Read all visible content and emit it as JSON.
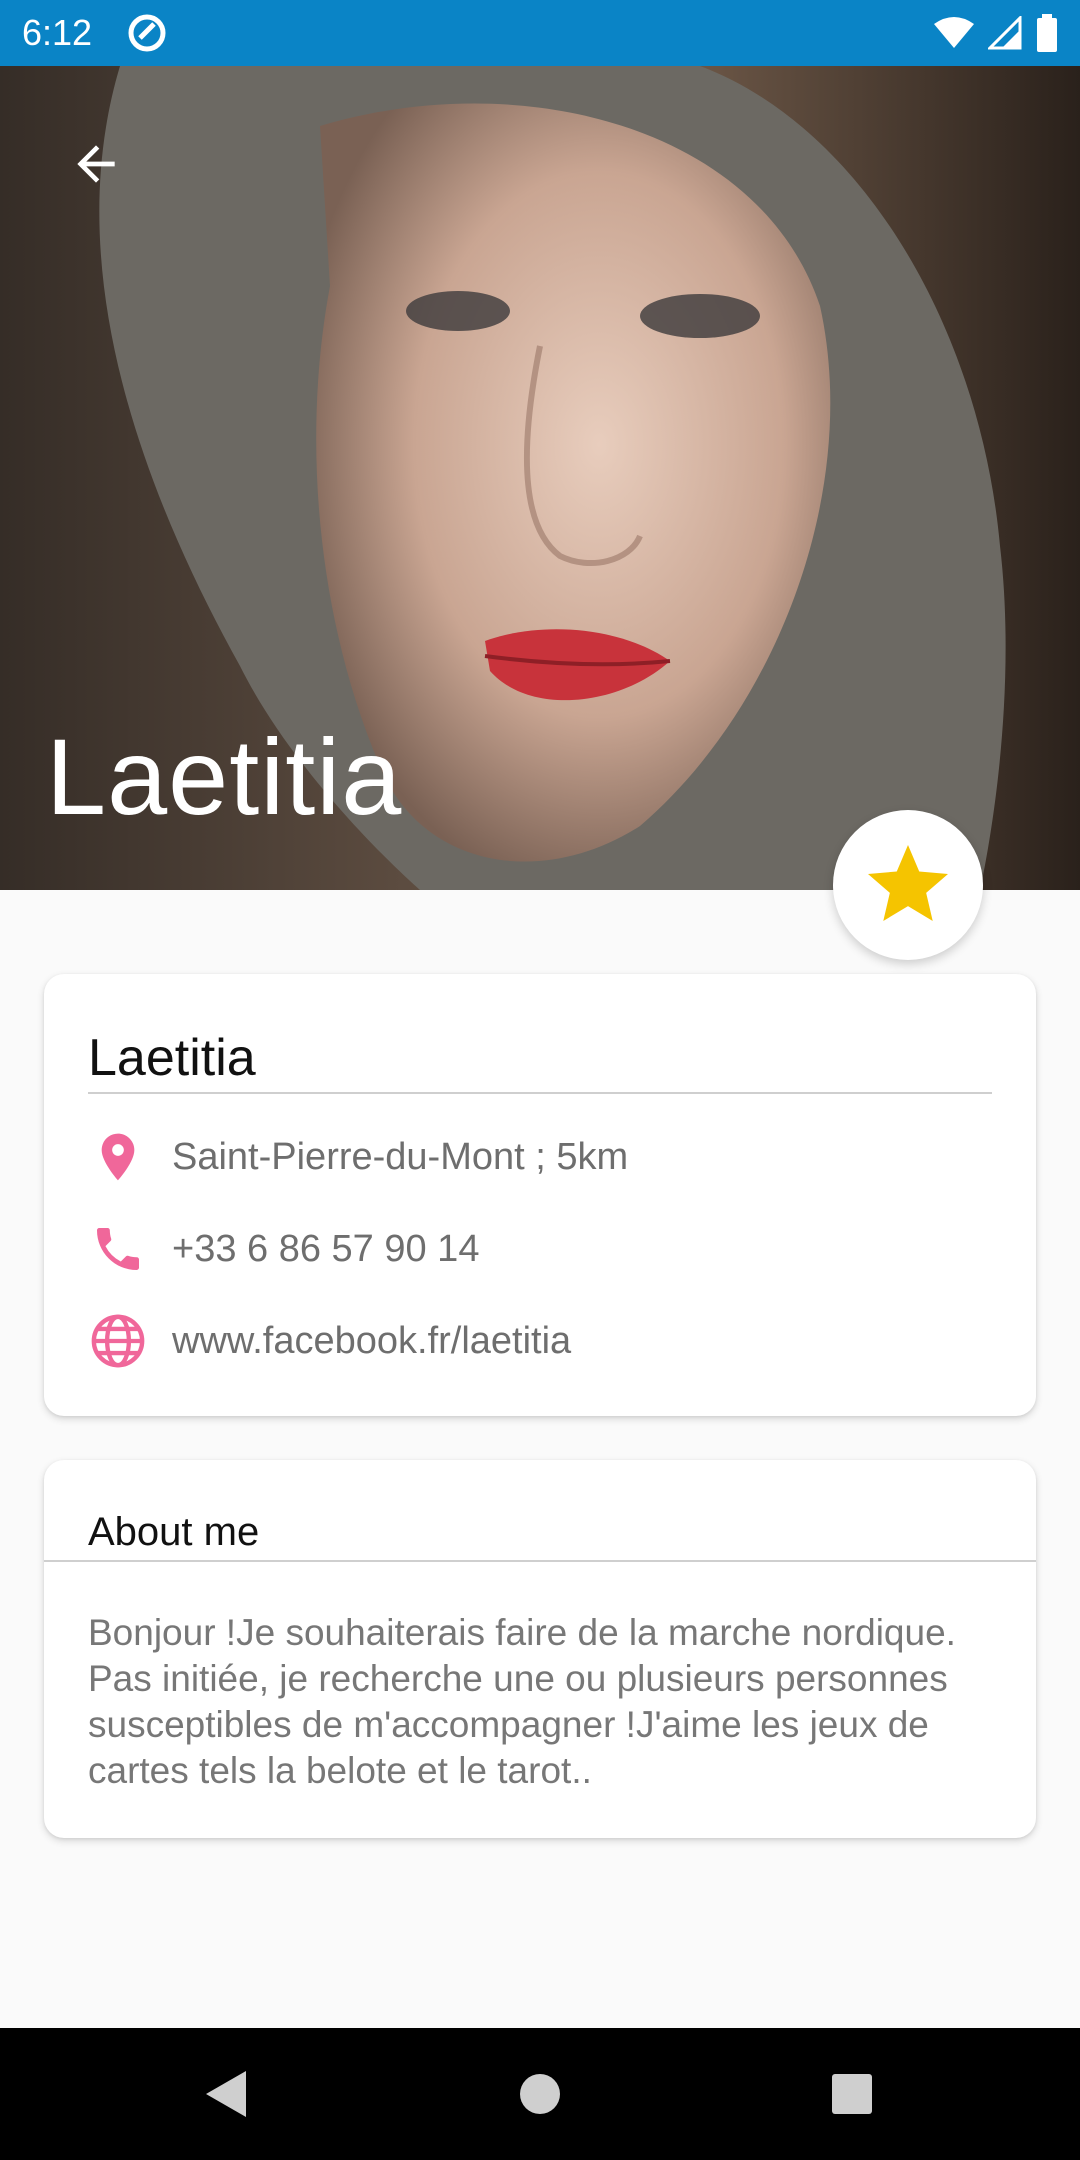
{
  "status_bar": {
    "time": "6:12"
  },
  "profile": {
    "hero_name": "Laetitia",
    "card_name": "Laetitia",
    "location": "Saint-Pierre-du-Mont ; 5km",
    "phone": "+33 6 86 57 90 14",
    "website": "www.facebook.fr/laetitia"
  },
  "about": {
    "title": "About me",
    "text": "Bonjour !Je souhaiterais faire de la marche nordique. Pas initiée, je recherche une ou plusieurs personnes susceptibles de m'accompagner !J'aime les jeux de cartes tels la belote et le tarot.."
  },
  "colors": {
    "status_bar": "#0a84c6",
    "accent_pink": "#f0679a",
    "star": "#f5c400"
  },
  "icons": [
    "back-arrow-icon",
    "star-icon",
    "location-pin-icon",
    "phone-icon",
    "globe-icon"
  ]
}
